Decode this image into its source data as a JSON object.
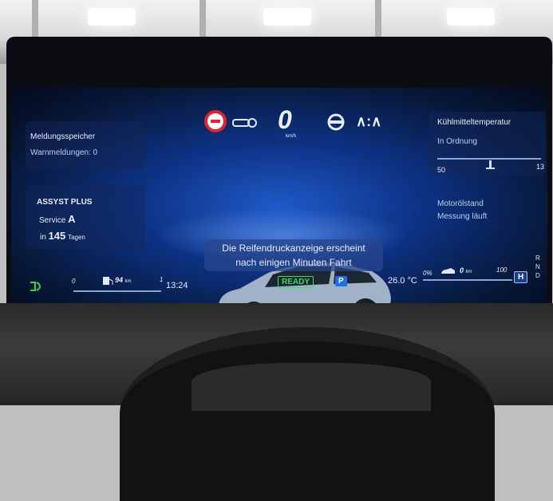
{
  "top_icons": {
    "speed_value": "0",
    "speed_unit": "km/h",
    "assist_glyph": "∧:∧"
  },
  "left_panel": {
    "messages_title": "Meldungsspeicher",
    "warnings": "Warnmeldungen: 0",
    "assyst_title": "ASSYST PLUS",
    "service_label": "Service",
    "service_value": "A",
    "in_label": "in",
    "days_value": "145",
    "days_unit": "Tagen"
  },
  "right_panel": {
    "coolant_title": "Kühlmitteltemperatur",
    "coolant_status": "In Ordnung",
    "scale_min": "50",
    "scale_max": "13",
    "oil_title": "Motorölstand",
    "oil_status": "Messung läuft"
  },
  "center": {
    "message_line1": "Die Reifendruckanzeige erscheint",
    "message_line2": "nach einigen Minuten Fahrt"
  },
  "bottom_bar": {
    "range_min": "0",
    "range_value": "94",
    "range_unit": "km",
    "range_max": "1",
    "time": "13:24",
    "ready": "READY",
    "park": "P",
    "temperature": "26.0 °C",
    "eco_min": "0%",
    "eco_value": "0",
    "eco_unit": "km",
    "eco_max": "100",
    "drive_mode": "H",
    "gears": [
      "R",
      "N",
      "D"
    ]
  },
  "colors": {
    "ready": "#3ddc63",
    "park": "#1f6fe8",
    "warning_red": "#e0242e",
    "lights_green": "#39d353"
  },
  "icons": [
    "speed-limit-icon",
    "distance-assist-icon",
    "steering-assist-icon",
    "headlight-icon",
    "fuel-pump-icon",
    "eco-car-icon"
  ]
}
